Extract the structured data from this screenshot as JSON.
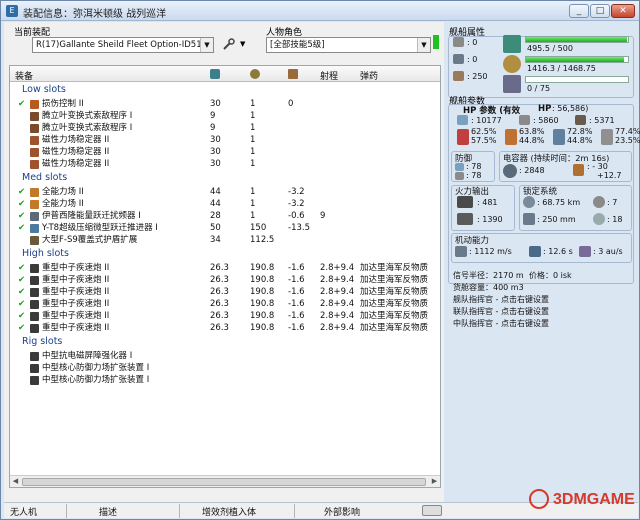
{
  "window": {
    "title": "装配信息：弥洱米顿级 战列巡洋",
    "min": "_",
    "max": "□",
    "close": "✕"
  },
  "fit": {
    "current_label": "当前装配",
    "current_value": "R(17)Gallante Sheild Fleet Option-ID51691",
    "char_label": "人物角色",
    "char_value": "[全部技能5级]"
  },
  "table": {
    "headers": {
      "name": "装备",
      "range": "射程",
      "ammo": "弹药"
    },
    "sections": [
      {
        "title": "Low slots",
        "rows": [
          {
            "name": "损伤控制 II",
            "c1": "30",
            "c2": "1",
            "c3": "0",
            "range": "",
            "ammo": "",
            "checked": true,
            "color": "#b65a1e"
          },
          {
            "name": "腾立叶变换式索敌程序 I",
            "c1": "9",
            "c2": "1",
            "c3": "",
            "range": "",
            "ammo": "",
            "checked": false,
            "color": "#7a4a2a"
          },
          {
            "name": "腾立叶变换式索敌程序 I",
            "c1": "9",
            "c2": "1",
            "c3": "",
            "range": "",
            "ammo": "",
            "checked": false,
            "color": "#7a4a2a"
          },
          {
            "name": "磁性力场稳定器 II",
            "c1": "30",
            "c2": "1",
            "c3": "",
            "range": "",
            "ammo": "",
            "checked": false,
            "color": "#a0522d"
          },
          {
            "name": "磁性力场稳定器 II",
            "c1": "30",
            "c2": "1",
            "c3": "",
            "range": "",
            "ammo": "",
            "checked": false,
            "color": "#a0522d"
          },
          {
            "name": "磁性力场稳定器 II",
            "c1": "30",
            "c2": "1",
            "c3": "",
            "range": "",
            "ammo": "",
            "checked": false,
            "color": "#a0522d"
          }
        ]
      },
      {
        "title": "Med slots",
        "rows": [
          {
            "name": "全能力场 II",
            "c1": "44",
            "c2": "1",
            "c3": "-3.2",
            "range": "",
            "ammo": "",
            "checked": true,
            "color": "#c07a2a"
          },
          {
            "name": "全能力场 II",
            "c1": "44",
            "c2": "1",
            "c3": "-3.2",
            "range": "",
            "ammo": "",
            "checked": true,
            "color": "#c07a2a"
          },
          {
            "name": "伊普西隆能量跃迁扰频器 I",
            "c1": "28",
            "c2": "1",
            "c3": "-0.6",
            "range": "9",
            "ammo": "",
            "checked": true,
            "color": "#5a6a7a"
          },
          {
            "name": "Y-T8超级压缩微型跃迁推进器 I",
            "c1": "50",
            "c2": "150",
            "c3": "-13.5",
            "range": "",
            "ammo": "",
            "checked": true,
            "color": "#4a7aa0"
          },
          {
            "name": "大型F-S9覆盖式护盾扩展",
            "c1": "34",
            "c2": "112.5",
            "c3": "",
            "range": "",
            "ammo": "",
            "checked": false,
            "color": "#6a5a3a"
          }
        ]
      },
      {
        "title": "High slots",
        "rows": [
          {
            "name": "重型中子疾速炮 II",
            "c1": "26.3",
            "c2": "190.8",
            "c3": "-1.6",
            "range": "2.8+9.4",
            "ammo": "加达里海军反物质",
            "checked": true,
            "color": "#3a3a3a"
          },
          {
            "name": "重型中子疾速炮 II",
            "c1": "26.3",
            "c2": "190.8",
            "c3": "-1.6",
            "range": "2.8+9.4",
            "ammo": "加达里海军反物质",
            "checked": true,
            "color": "#3a3a3a"
          },
          {
            "name": "重型中子疾速炮 II",
            "c1": "26.3",
            "c2": "190.8",
            "c3": "-1.6",
            "range": "2.8+9.4",
            "ammo": "加达里海军反物质",
            "checked": true,
            "color": "#3a3a3a"
          },
          {
            "name": "重型中子疾速炮 II",
            "c1": "26.3",
            "c2": "190.8",
            "c3": "-1.6",
            "range": "2.8+9.4",
            "ammo": "加达里海军反物质",
            "checked": true,
            "color": "#3a3a3a"
          },
          {
            "name": "重型中子疾速炮 II",
            "c1": "26.3",
            "c2": "190.8",
            "c3": "-1.6",
            "range": "2.8+9.4",
            "ammo": "加达里海军反物质",
            "checked": true,
            "color": "#3a3a3a"
          },
          {
            "name": "重型中子疾速炮 II",
            "c1": "26.3",
            "c2": "190.8",
            "c3": "-1.6",
            "range": "2.8+9.4",
            "ammo": "加达里海军反物质",
            "checked": true,
            "color": "#3a3a3a"
          }
        ]
      },
      {
        "title": "Rig slots",
        "rows": [
          {
            "name": "中型抗电磁屏障强化器 I",
            "c1": "",
            "c2": "",
            "c3": "",
            "range": "",
            "ammo": "",
            "checked": false,
            "color": "#3a3a3a"
          },
          {
            "name": "中型核心防御力场扩张装置 I",
            "c1": "",
            "c2": "",
            "c3": "",
            "range": "",
            "ammo": "",
            "checked": false,
            "color": "#3a3a3a"
          },
          {
            "name": "中型核心防御力场扩张装置 I",
            "c1": "",
            "c2": "",
            "c3": "",
            "range": "",
            "ammo": "",
            "checked": false,
            "color": "#3a3a3a"
          }
        ]
      }
    ]
  },
  "status": {
    "s1": "无人机",
    "s2": "描述",
    "s3": "增效剂植入体",
    "s4": "外部影响"
  },
  "ship": {
    "attr_title": "舰船属性",
    "hi": ": 0",
    "med": ": 0",
    "lo": ": 250",
    "cpu": "495.5 / 500",
    "cpu_frac": 0.99,
    "pg": "1416.3 / 1468.75",
    "pg_frac": 0.964,
    "cal": "0 / 75",
    "cal_frac": 0,
    "params_title": "舰船参数",
    "hp_label": "HP 参数 (有效",
    "hp_label2": "HP",
    "hp_value": ":  56,586)",
    "hp_a": ": 10177",
    "hp_b": ": 5860",
    "hp_c": ": 5371",
    "res": [
      [
        "62.5%",
        "57.5%"
      ],
      [
        "63.8%",
        "44.8%"
      ],
      [
        "72.8%",
        "44.8%"
      ],
      [
        "77.4%",
        "23.5%"
      ]
    ],
    "def_title": "防御",
    "def1": ": 78",
    "def2": ": 78",
    "cap_title": "电容器 (持续时间：2m 16s)",
    "cap_val": ": 2848",
    "cap_rate": ": - 30",
    "cap_rate2": "+12.7",
    "fire_title": "火力输出",
    "fire1": ": 481",
    "fire2": ": 1390",
    "lock_title": "锁定系统",
    "lock_range": ": 68.75 km",
    "lock_targets": ": 7",
    "scan_res": ": 250 mm",
    "sensor": ": 18",
    "mob_title": "机动能力",
    "speed": ": 1112 m/s",
    "align": ": 12.6 s",
    "warp": ": 3 au/s",
    "sig": "信号半径：2170 m",
    "price": "价格：0 isk",
    "cargo": "货舱容量：400 m3",
    "fleet": "舰队指挥官 - 点击右键设置",
    "wing": "联队指挥官 - 点击右键设置",
    "squad": "中队指挥官 - 点击右键设置"
  },
  "watermark": "3DMGAME"
}
